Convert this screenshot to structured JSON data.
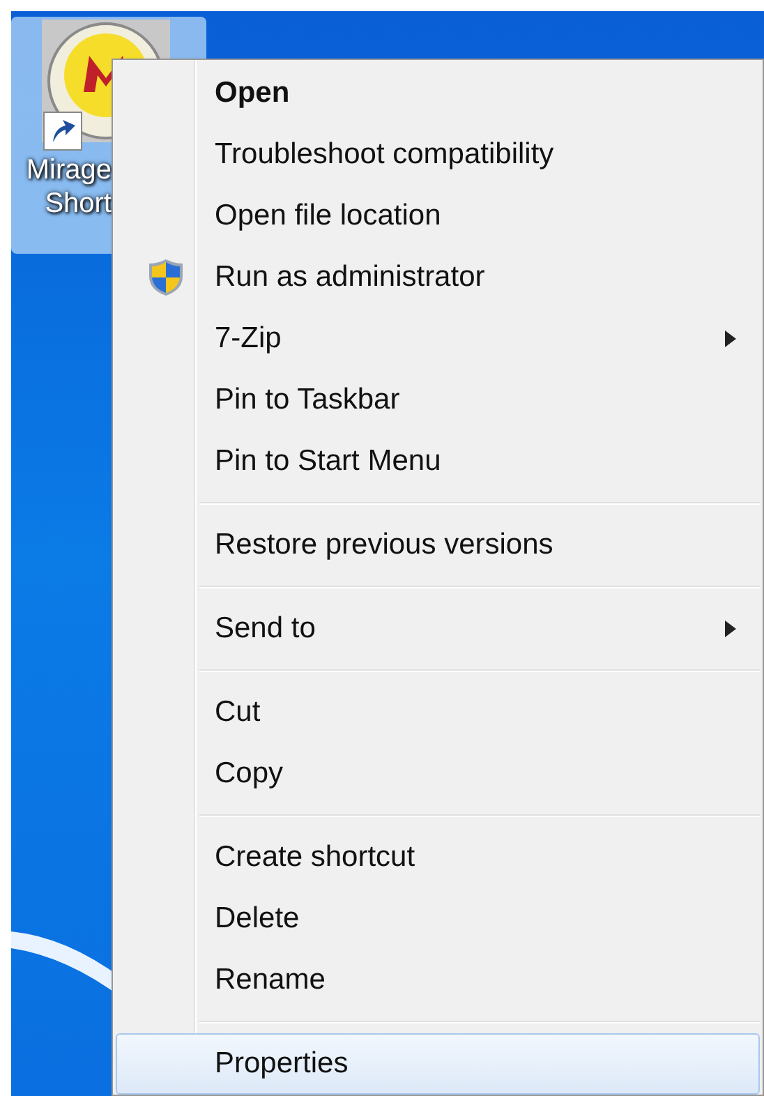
{
  "desktop_icon": {
    "label_lines": [
      "Mirage",
      "Short"
    ],
    "selected": true
  },
  "context_menu": {
    "items": [
      {
        "kind": "item",
        "label": "Open",
        "bold": true,
        "submenu": false,
        "selected": false
      },
      {
        "kind": "item",
        "label": "Troubleshoot compatibility",
        "bold": false,
        "submenu": false,
        "selected": false
      },
      {
        "kind": "item",
        "label": "Open file location",
        "bold": false,
        "submenu": false,
        "selected": false
      },
      {
        "kind": "shielded",
        "label": "Run as administrator",
        "bold": false,
        "submenu": false,
        "selected": false
      },
      {
        "kind": "item",
        "label": "7-Zip",
        "bold": false,
        "submenu": true,
        "selected": false
      },
      {
        "kind": "item",
        "label": "Pin to Taskbar",
        "bold": false,
        "submenu": false,
        "selected": false
      },
      {
        "kind": "item",
        "label": "Pin to Start Menu",
        "bold": false,
        "submenu": false,
        "selected": false
      },
      {
        "kind": "separator"
      },
      {
        "kind": "item",
        "label": "Restore previous versions",
        "bold": false,
        "submenu": false,
        "selected": false
      },
      {
        "kind": "separator"
      },
      {
        "kind": "item",
        "label": "Send to",
        "bold": false,
        "submenu": true,
        "selected": false
      },
      {
        "kind": "separator"
      },
      {
        "kind": "item",
        "label": "Cut",
        "bold": false,
        "submenu": false,
        "selected": false
      },
      {
        "kind": "item",
        "label": "Copy",
        "bold": false,
        "submenu": false,
        "selected": false
      },
      {
        "kind": "separator"
      },
      {
        "kind": "item",
        "label": "Create shortcut",
        "bold": false,
        "submenu": false,
        "selected": false
      },
      {
        "kind": "item",
        "label": "Delete",
        "bold": false,
        "submenu": false,
        "selected": false
      },
      {
        "kind": "item",
        "label": "Rename",
        "bold": false,
        "submenu": false,
        "selected": false
      },
      {
        "kind": "separator"
      },
      {
        "kind": "item",
        "label": "Properties",
        "bold": false,
        "submenu": false,
        "selected": true
      }
    ]
  }
}
